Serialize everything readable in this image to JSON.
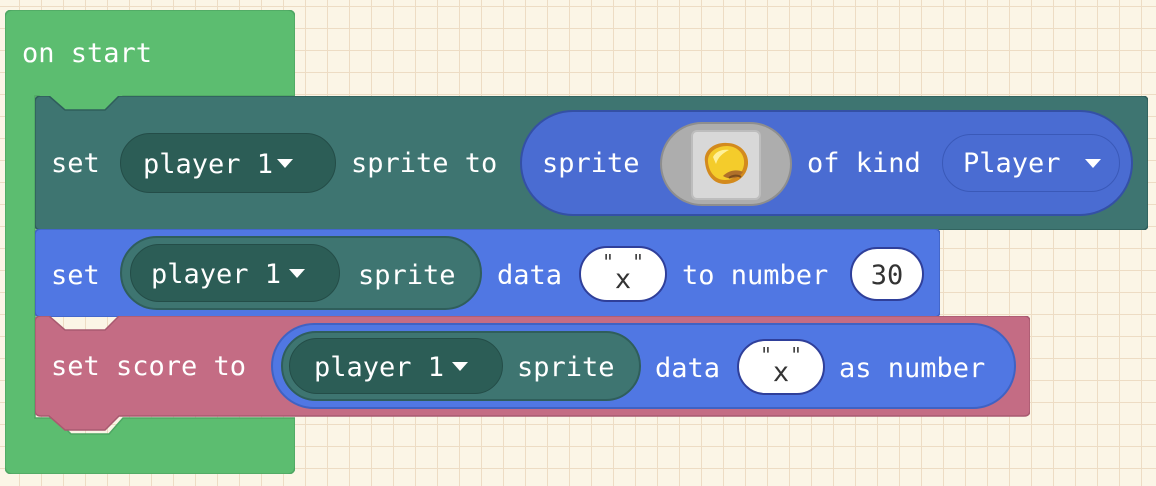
{
  "on_start": {
    "label": "on start"
  },
  "set_sprite_block": {
    "label_set": "set",
    "variable": "player 1",
    "label_sprite_to": "sprite to",
    "create_sprite": {
      "label_sprite": "sprite",
      "image_icon": "lemon-sprite-icon",
      "label_of_kind": "of kind",
      "kind": "Player"
    }
  },
  "set_data_block": {
    "label_set": "set",
    "variable": "player 1",
    "label_sprite": "sprite",
    "label_data": "data",
    "key": "x",
    "label_to_number": "to number",
    "value": "30"
  },
  "set_score_block": {
    "label_set_score_to": "set score to",
    "variable": "player 1",
    "label_sprite": "sprite",
    "label_data": "data",
    "key": "x",
    "label_as_number": "as number"
  },
  "colors": {
    "events": "#5cbd70",
    "sprites": "#3e7571",
    "sprites_dark": "#2c5d56",
    "data": "#5077e3",
    "info": "#c46c84",
    "sprite_image_bg": "#adadad"
  }
}
